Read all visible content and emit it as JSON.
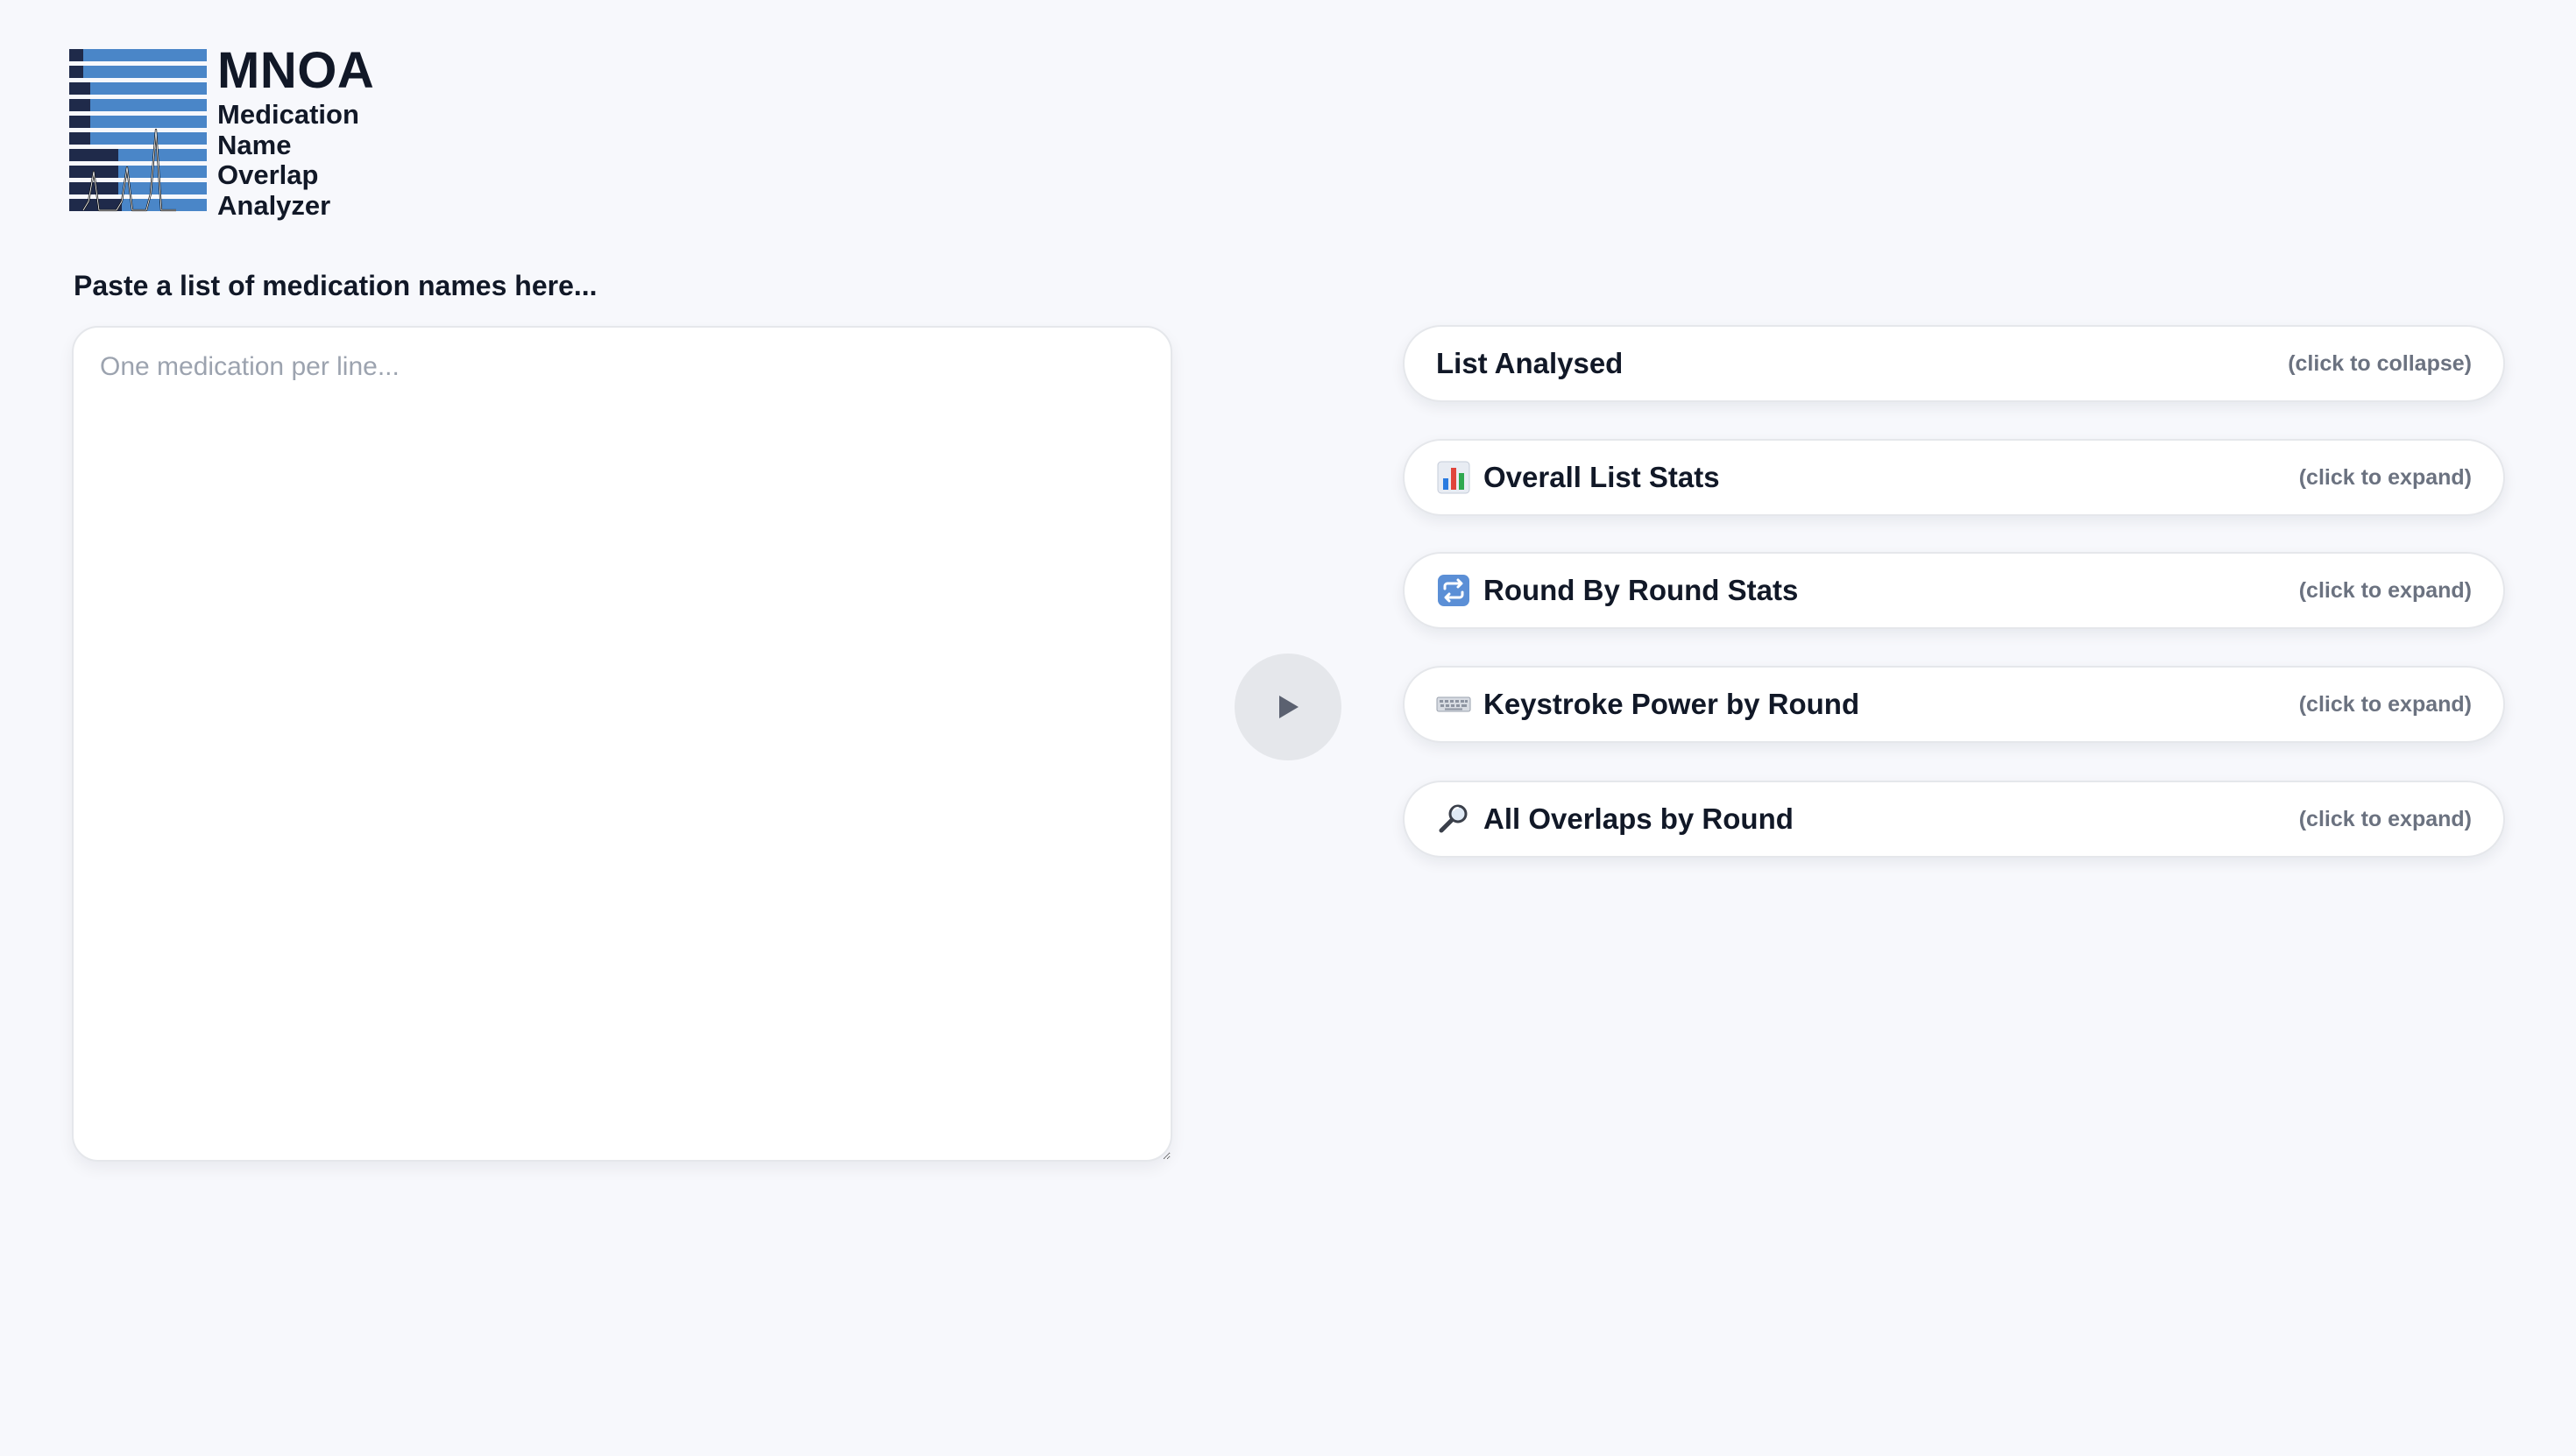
{
  "logo": {
    "title": "MNOA",
    "line1": "Medication",
    "line2": "Name",
    "line3": "Overlap",
    "line4": "Analyzer"
  },
  "input": {
    "label": "Paste a list of medication names here...",
    "placeholder": "One medication per line...",
    "value": ""
  },
  "run_button": {
    "icon": "play-icon"
  },
  "panels": [
    {
      "title": "List Analysed",
      "hint": "(click to collapse)",
      "icon": ""
    },
    {
      "title": "Overall List Stats",
      "hint": "(click to expand)",
      "icon": "bar-chart-icon"
    },
    {
      "title": "Round By Round Stats",
      "hint": "(click to expand)",
      "icon": "repeat-icon"
    },
    {
      "title": "Keystroke Power by Round",
      "hint": "(click to expand)",
      "icon": "keyboard-icon"
    },
    {
      "title": "All Overlaps by Round",
      "hint": "(click to expand)",
      "icon": "magnifier-icon"
    }
  ],
  "colors": {
    "background": "#f7f8fc",
    "logo_dark": "#1f2a4a",
    "logo_blue": "#4a86c8",
    "run_button_bg": "#e5e7eb",
    "hint_text": "#6b7280"
  }
}
